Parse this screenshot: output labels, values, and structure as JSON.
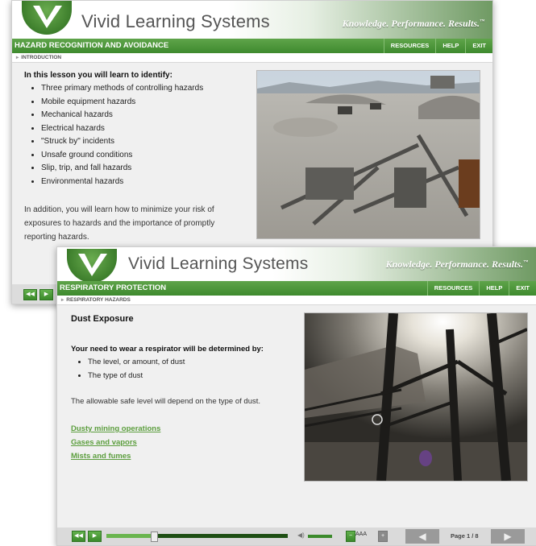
{
  "brand": {
    "name": "Vivid Learning Systems",
    "tagline": "Knowledge. Performance. Results.",
    "trademark": "™"
  },
  "nav": {
    "resources": "RESOURCES",
    "help": "HELP",
    "exit": "EXIT"
  },
  "colors": {
    "accent": "#4a9638",
    "link": "#5c9e3e",
    "panel": "#f0f0f0"
  },
  "window1": {
    "course": "HAZARD RECOGNITION AND AVOIDANCE",
    "section": "INTRODUCTION",
    "heading": "In this lesson you will learn to identify:",
    "items": [
      "Three primary methods of controlling hazards",
      "Mobile equipment hazards",
      "Mechanical hazards",
      "Electrical hazards",
      "\"Struck by\" incidents",
      "Unsafe ground conditions",
      "Slip, trip, and fall hazards",
      "Environmental hazards"
    ],
    "paragraph": "In addition, you will learn how to minimize your risk of exposures to hazards and the importance of promptly reporting hazards.",
    "controls": {
      "rewind_icon": "rewind-icon",
      "play_icon": "play-icon"
    }
  },
  "window2": {
    "course": "RESPIRATORY PROTECTION",
    "section": "RESPIRATORY HAZARDS",
    "title": "Dust Exposure",
    "lead": "Your need to wear a respirator will be determined by:",
    "items": [
      "The level, or amount, of dust",
      "The type of dust"
    ],
    "paragraph": "The allowable safe level will depend on the type of dust.",
    "links": [
      "Dusty mining operations",
      "Gases and vapors",
      "Mists and fumes"
    ],
    "player": {
      "progress": 0.26,
      "text_size_label": "AAA",
      "page": "Page 1 / 8"
    }
  }
}
